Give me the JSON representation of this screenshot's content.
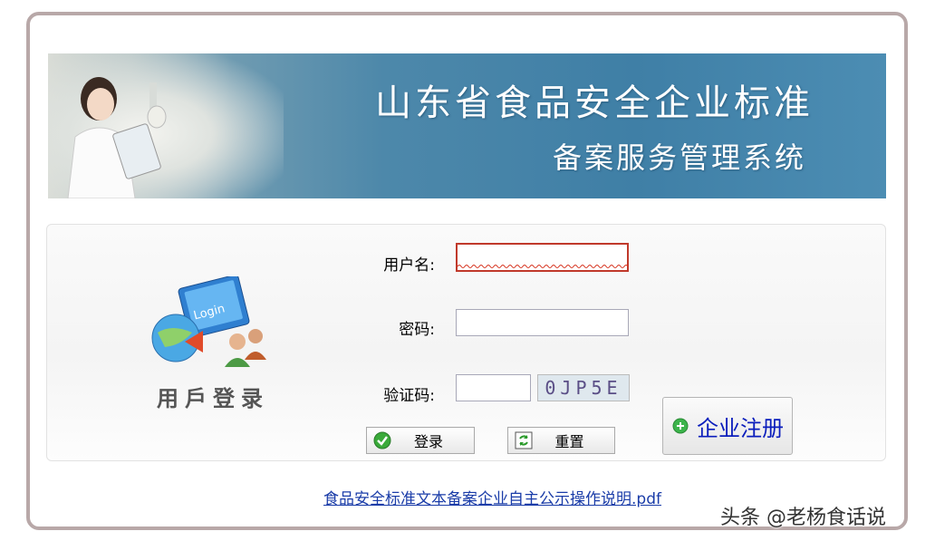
{
  "banner": {
    "title": "山东省食品安全企业标准",
    "subtitle": "备案服务管理系统"
  },
  "login_logo": {
    "badge_text": "Login",
    "label": "用戶登录"
  },
  "form": {
    "username_label": "用户名:",
    "username_value": "",
    "password_label": "密码:",
    "password_value": "",
    "captcha_label": "验证码:",
    "captcha_value": "",
    "captcha_image_text": "0JP5E"
  },
  "buttons": {
    "login_label": "登录",
    "reset_label": "重置",
    "register_label": "企业注册"
  },
  "links": {
    "pdf_label": "食品安全标准文本备案企业自主公示操作说明.pdf"
  },
  "watermark": "头条 @老杨食话说",
  "colors": {
    "banner_blue": "#4d88aa",
    "link_blue": "#1a3ca8",
    "register_text": "#0a1dbc",
    "active_border": "#c0392b"
  },
  "icons": {
    "login_button": "check-circle-icon",
    "reset_button": "refresh-icon",
    "register_button": "plus-circle-icon"
  }
}
